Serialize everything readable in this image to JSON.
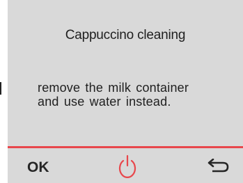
{
  "screen": {
    "title": "Cappuccino cleaning",
    "message_lines": [
      "remove the milk container",
      "and use water instead."
    ]
  },
  "footer": {
    "ok_label": "OK",
    "power_icon": "power-icon",
    "back_icon": "back-arrow-icon"
  },
  "colors": {
    "screen_background": "#d9d9d9",
    "accent": "#e8474c",
    "text": "#1f1f1f"
  }
}
